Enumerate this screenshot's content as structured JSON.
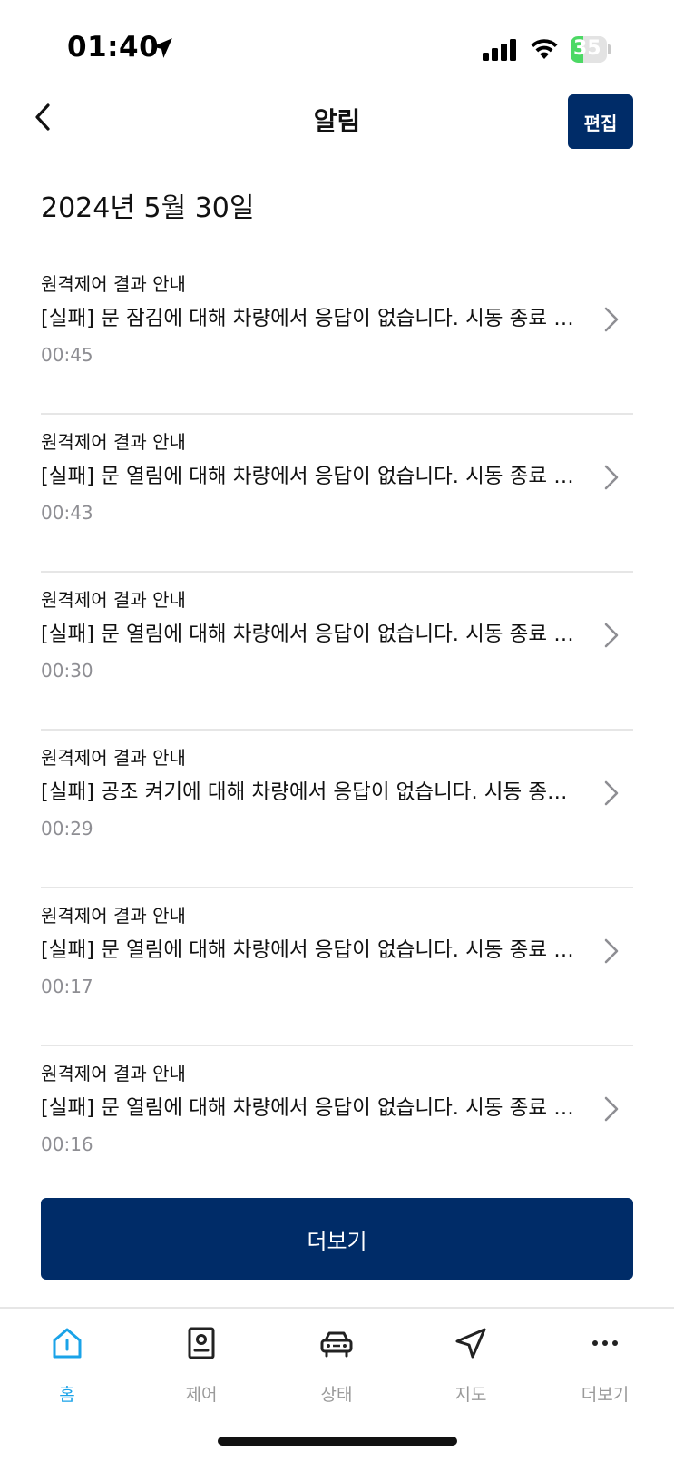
{
  "status_bar": {
    "time": "01:40",
    "battery": "35",
    "battery_level": 0.35
  },
  "header": {
    "title": "알림",
    "edit_label": "편집"
  },
  "date": "2024년 5월 30일",
  "notifications": [
    {
      "category": "원격제어 결과 안내",
      "message": "[실패] 문 잠김에 대해 차량에서 응답이 없습니다. 시동 종료 상태에서 다시 시도해 주세요.",
      "time": "00:45"
    },
    {
      "category": "원격제어 결과 안내",
      "message": "[실패] 문 열림에 대해 차량에서 응답이 없습니다. 시동 종료 상태에서 다시 시도해 주세요.",
      "time": "00:43"
    },
    {
      "category": "원격제어 결과 안내",
      "message": "[실패] 문 열림에 대해 차량에서 응답이 없습니다. 시동 종료 상태에서 다시 시도해 주세요.",
      "time": "00:30"
    },
    {
      "category": "원격제어 결과 안내",
      "message": "[실패] 공조 켜기에 대해 차량에서 응답이 없습니다. 시동 종료 상태에서 다시 시도해 주세요.",
      "time": "00:29"
    },
    {
      "category": "원격제어 결과 안내",
      "message": "[실패] 문 열림에 대해 차량에서 응답이 없습니다. 시동 종료 상태에서 다시 시도해 주세요.",
      "time": "00:17"
    },
    {
      "category": "원격제어 결과 안내",
      "message": "[실패] 문 열림에 대해 차량에서 응답이 없습니다. 시동 종료 상태에서 다시 시도해 주세요.",
      "time": "00:16"
    }
  ],
  "more_label": "더보기",
  "tabs": [
    {
      "label": "홈",
      "icon": "home-icon",
      "active": true
    },
    {
      "label": "제어",
      "icon": "control-icon",
      "active": false
    },
    {
      "label": "상태",
      "icon": "car-icon",
      "active": false
    },
    {
      "label": "지도",
      "icon": "navigation-icon",
      "active": false
    },
    {
      "label": "더보기",
      "icon": "more-dots-icon",
      "active": false
    }
  ],
  "colors": {
    "primary": "#002c68",
    "accent": "#1aa3e8",
    "muted": "#8e8e93",
    "battery_green": "#4cd964"
  }
}
